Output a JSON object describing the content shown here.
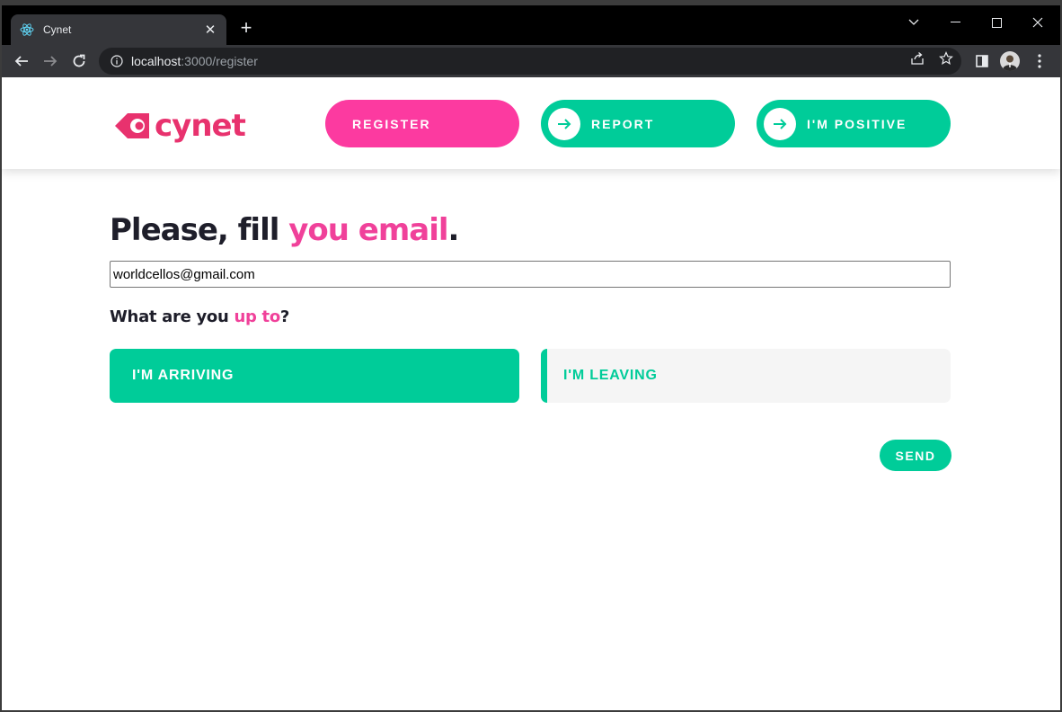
{
  "browser": {
    "tab_title": "Cynet",
    "url_host": "localhost",
    "url_path": ":3000/register"
  },
  "nav": {
    "logo_text": "cynet",
    "register": "REGISTER",
    "report": "REPORT",
    "positive": "I'M POSITIVE"
  },
  "form": {
    "heading_pre": "Please, fill ",
    "heading_accent": "you email",
    "heading_post": ".",
    "email_value": "worldcellos@gmail.com",
    "question_pre": "What are you ",
    "question_accent": "up to",
    "question_post": "?",
    "option_arriving": "I'M ARRIVING",
    "option_leaving": "I'M LEAVING",
    "send": "SEND"
  },
  "colors": {
    "pink": "#fc3aa0",
    "green": "#00cc99",
    "logo": "#e8326e"
  }
}
